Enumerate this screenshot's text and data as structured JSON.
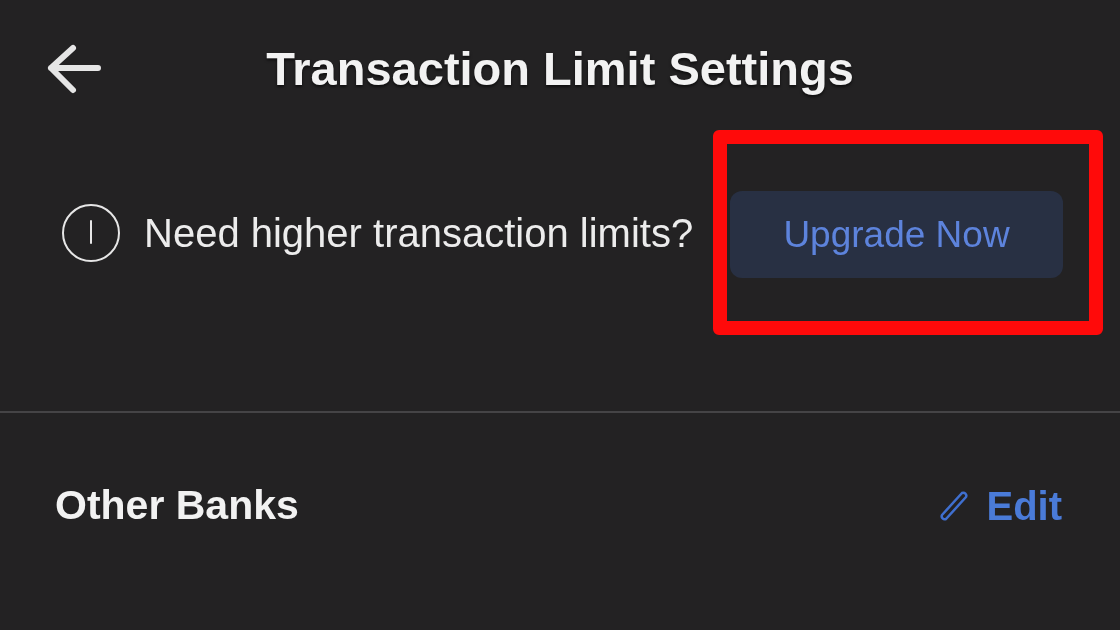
{
  "header": {
    "title": "Transaction Limit Settings"
  },
  "upgrade_prompt": {
    "message": "Need higher transaction limits?",
    "button": "Upgrade Now",
    "highlighted": true
  },
  "section": {
    "title": "Other Banks",
    "action": "Edit"
  }
}
